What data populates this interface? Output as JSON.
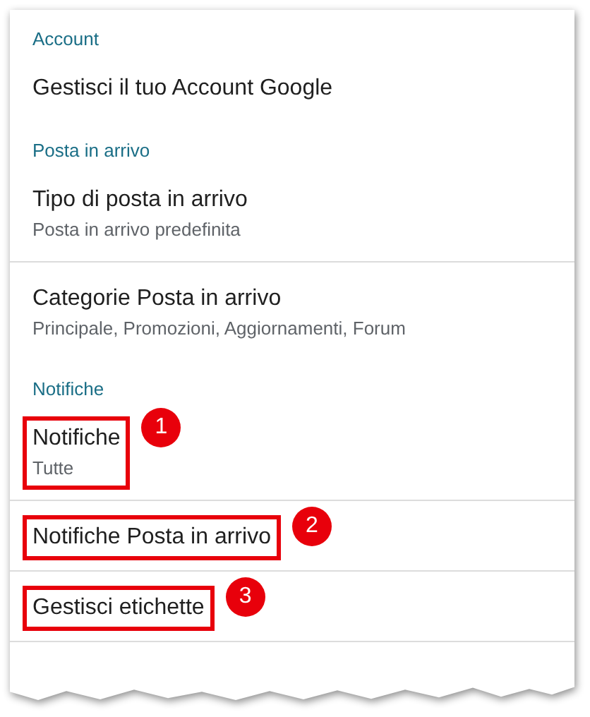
{
  "sections": [
    {
      "header": "Account",
      "items": [
        {
          "title": "Gestisci il tuo Account Google",
          "divided": false,
          "highlighted": false
        }
      ]
    },
    {
      "header": "Posta in arrivo",
      "items": [
        {
          "title": "Tipo di posta in arrivo",
          "subtitle": "Posta in arrivo predefinita",
          "divided": true,
          "highlighted": false
        },
        {
          "title": "Categorie Posta in arrivo",
          "subtitle": "Principale, Promozioni, Aggiornamenti, Forum",
          "divided": false,
          "highlighted": false
        }
      ]
    },
    {
      "header": "Notifiche",
      "items": [
        {
          "title": "Notifiche",
          "subtitle": "Tutte",
          "divided": true,
          "highlighted": true,
          "callout": "1"
        },
        {
          "title": "Notifiche Posta in arrivo",
          "divided": true,
          "highlighted": true,
          "callout": "2"
        },
        {
          "title": "Gestisci etichette",
          "divided": true,
          "highlighted": true,
          "callout": "3"
        }
      ]
    }
  ]
}
